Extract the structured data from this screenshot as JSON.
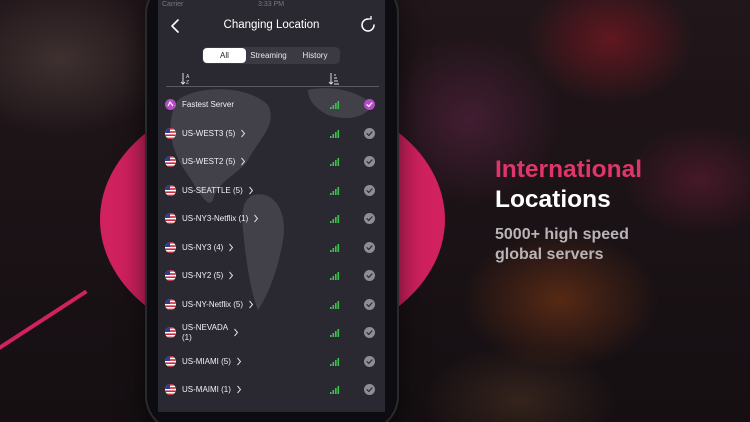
{
  "status": {
    "carrier": "Carrier",
    "time": "3:33 PM"
  },
  "nav": {
    "title": "Changing Location",
    "back_icon": "chevron-left-icon",
    "refresh_icon": "refresh-icon"
  },
  "tabs": [
    {
      "label": "All",
      "active": true
    },
    {
      "label": "Streaming",
      "active": false
    },
    {
      "label": "History",
      "active": false
    }
  ],
  "sort": {
    "left_icon": "sort-az-icon",
    "right_icon": "sort-ascending-icon"
  },
  "servers": [
    {
      "name": "Fastest Server",
      "icon": "fastest-server-icon",
      "selected": true,
      "chevron": false
    },
    {
      "name": "US-WEST3 (5)",
      "icon": "us-flag-icon",
      "selected": false,
      "chevron": true
    },
    {
      "name": "US-WEST2 (5)",
      "icon": "us-flag-icon",
      "selected": false,
      "chevron": true
    },
    {
      "name": "US-SEATTLE (5)",
      "icon": "us-flag-icon",
      "selected": false,
      "chevron": true
    },
    {
      "name": "US-NY3-Netflix (1)",
      "icon": "us-flag-icon",
      "selected": false,
      "chevron": true
    },
    {
      "name": "US-NY3 (4)",
      "icon": "us-flag-icon",
      "selected": false,
      "chevron": true
    },
    {
      "name": "US-NY2 (5)",
      "icon": "us-flag-icon",
      "selected": false,
      "chevron": true
    },
    {
      "name": "US-NY-Netflix (5)",
      "icon": "us-flag-icon",
      "selected": false,
      "chevron": true
    },
    {
      "name": "US-NEVADA (1)",
      "icon": "us-flag-icon",
      "selected": false,
      "chevron": true
    },
    {
      "name": "US-MIAMI (5)",
      "icon": "us-flag-icon",
      "selected": false,
      "chevron": true
    },
    {
      "name": "US-MAIMI (1)",
      "icon": "us-flag-icon",
      "selected": false,
      "chevron": true
    }
  ],
  "promo": {
    "headline_line1": "International",
    "headline_line2": "Locations",
    "sub_line1": "5000+ high speed",
    "sub_line2": "global servers"
  },
  "colors": {
    "accent": "#e0356b",
    "brand_pink": "#d1215f",
    "selected_check": "#b44cc4",
    "signal_green": "#3fc24a",
    "unselected_check": "#8e8d94"
  }
}
